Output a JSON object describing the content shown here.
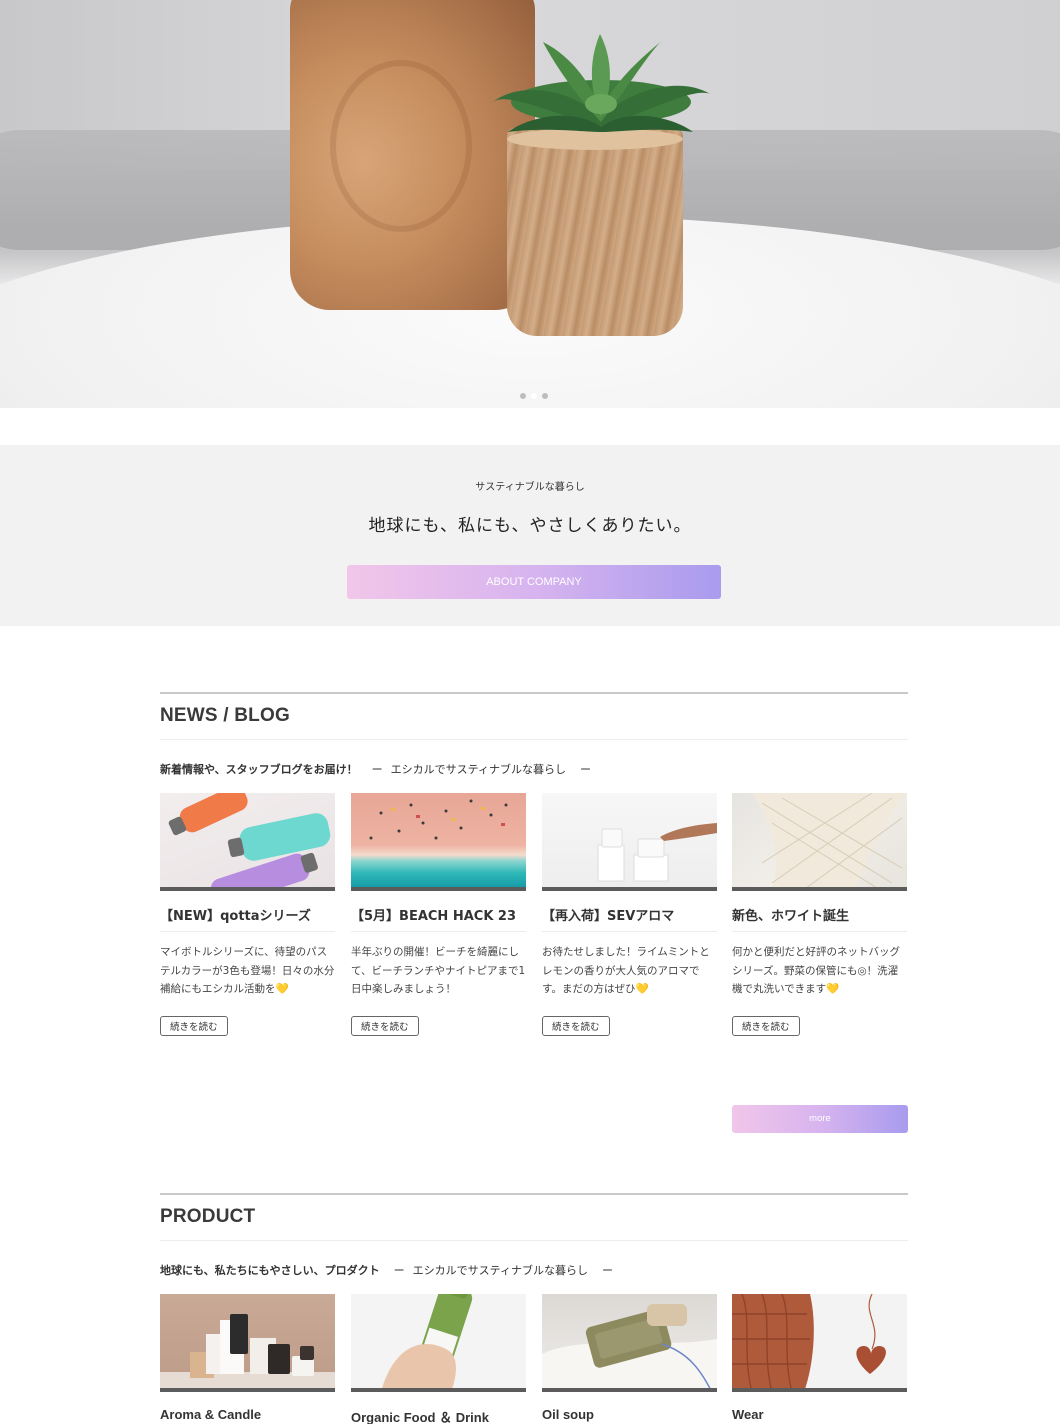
{
  "hero": {
    "slide_count": 3,
    "active_slide": 2
  },
  "about": {
    "subtitle": "サスティナブルな暮らし",
    "headline": "地球にも、私にも、やさしくありたい。",
    "button_label": "ABOUT COMPANY"
  },
  "news": {
    "heading": "NEWS / BLOG",
    "lead_bold": "新着情報や、スタッフブログをお届け！",
    "lead_dash_left": "ー",
    "lead_tag": "エシカルでサスティナブルな暮らし",
    "lead_dash_right": "ー",
    "posts": [
      {
        "title": "【NEW】qottaシリーズ",
        "text": "マイボトルシリーズに、待望のパステルカラーが3色も登場！日々の水分補給にもエシカル活動を",
        "emoji": "💛",
        "read_more": "続きを読む"
      },
      {
        "title": "【5月】BEACH HACK 23",
        "text": "半年ぶりの開催！ビーチを綺麗にして、ビーチランチやナイトピアまで1日中楽しみましょう！",
        "emoji": "",
        "read_more": "続きを読む"
      },
      {
        "title": "【再入荷】SEVアロマ",
        "text": "お待たせしました！ライムミントとレモンの香りが大人気のアロマです。まだの方はぜひ",
        "emoji": "💛",
        "read_more": "続きを読む"
      },
      {
        "title": "新色、ホワイト誕生",
        "text": "何かと便利だと好評のネットバッグシリーズ。野菜の保管にも◎！洗濯機で丸洗いできます",
        "emoji": "💛",
        "read_more": "続きを読む"
      }
    ],
    "more_label": "more"
  },
  "product": {
    "heading": "PRODUCT",
    "lead_bold": "地球にも、私たちにもやさしい、プロダクト",
    "lead_dash_left": "ー",
    "lead_tag": "エシカルでサスティナブルな暮らし",
    "lead_dash_right": "ー",
    "items": [
      {
        "title": "Aroma & Candle"
      },
      {
        "title": "Organic Food ＆ Drink"
      },
      {
        "title": "Oil soup"
      },
      {
        "title": "Wear"
      }
    ]
  },
  "colors": {
    "gradient_start": "#f2c6ea",
    "gradient_end": "#a99bee",
    "band_bg": "#f2f2f2",
    "heart": "#f3c03c"
  }
}
